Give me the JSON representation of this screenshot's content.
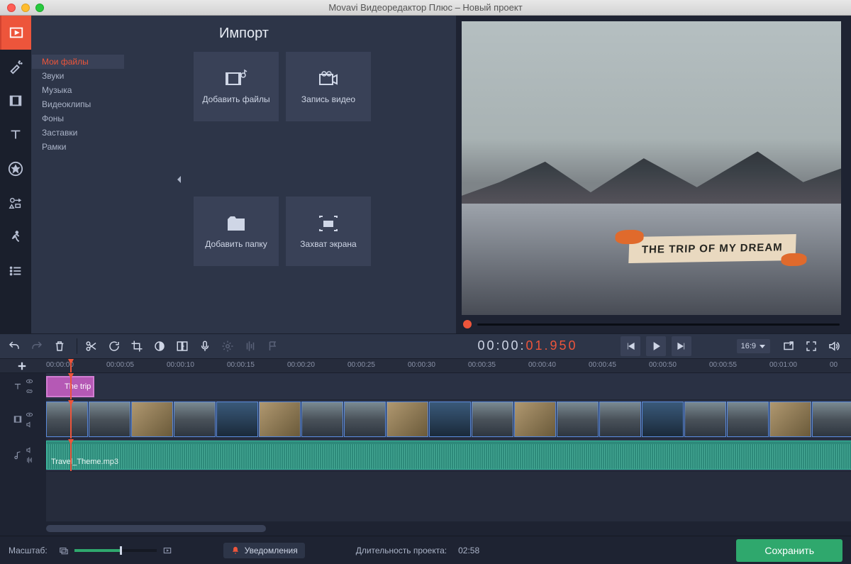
{
  "window": {
    "title": "Movavi Видеоредактор Плюс – Новый проект"
  },
  "leftbar": [
    {
      "name": "import",
      "icon": "film-play",
      "active": true
    },
    {
      "name": "filters",
      "icon": "wand"
    },
    {
      "name": "transitions",
      "icon": "film-strip"
    },
    {
      "name": "titles",
      "icon": "text"
    },
    {
      "name": "stickers",
      "icon": "star-circle"
    },
    {
      "name": "callouts",
      "icon": "shapes"
    },
    {
      "name": "animation",
      "icon": "runner"
    },
    {
      "name": "more",
      "icon": "list"
    }
  ],
  "panel": {
    "title": "Импорт",
    "categories": [
      "Мои файлы",
      "Звуки",
      "Музыка",
      "Видеоклипы",
      "Фоны",
      "Заставки",
      "Рамки"
    ],
    "selected": 0,
    "buttons": {
      "add_files": "Добавить файлы",
      "record_video": "Запись видео",
      "add_folder": "Добавить папку",
      "screen_capture": "Захват экрана"
    }
  },
  "preview": {
    "overlay_text": "THE TRIP OF MY DREAM"
  },
  "toolbar": {
    "timecode_gray": "00:00:",
    "timecode_red": "01.950",
    "aspect": "16:9"
  },
  "timeline": {
    "ruler": [
      "00:00:00",
      "00:00:05",
      "00:00:10",
      "00:00:15",
      "00:00:20",
      "00:00:25",
      "00:00:30",
      "00:00:35",
      "00:00:40",
      "00:00:45",
      "00:00:50",
      "00:00:55",
      "00:01:00",
      "00"
    ],
    "title_clip": "The trip",
    "audio_clip": "Travel_Theme.mp3"
  },
  "bottom": {
    "zoom_label": "Масштаб:",
    "notifications": "Уведомления",
    "duration_label": "Длительность проекта:",
    "duration_value": "02:58",
    "save": "Сохранить"
  }
}
